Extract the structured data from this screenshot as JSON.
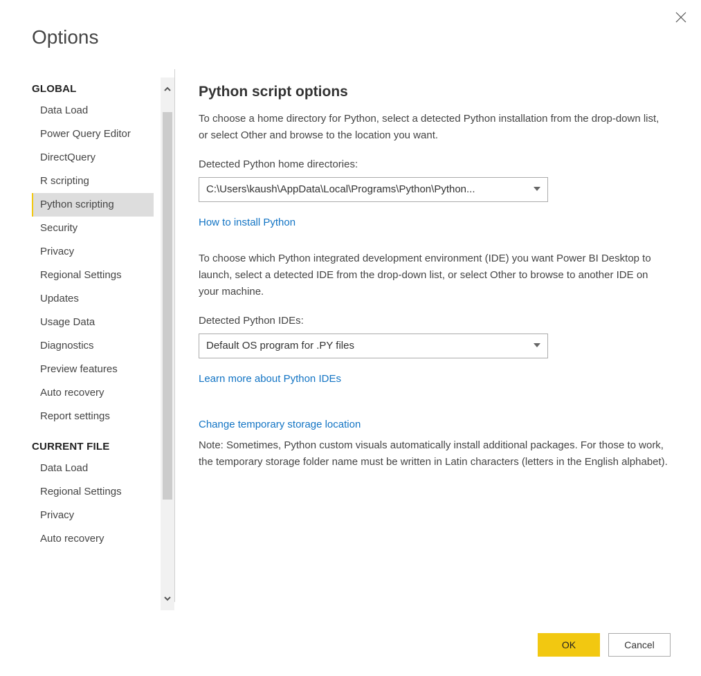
{
  "dialog_title": "Options",
  "sidebar": {
    "groups": [
      {
        "header": "GLOBAL",
        "items": [
          {
            "label": "Data Load",
            "selected": false
          },
          {
            "label": "Power Query Editor",
            "selected": false
          },
          {
            "label": "DirectQuery",
            "selected": false
          },
          {
            "label": "R scripting",
            "selected": false
          },
          {
            "label": "Python scripting",
            "selected": true
          },
          {
            "label": "Security",
            "selected": false
          },
          {
            "label": "Privacy",
            "selected": false
          },
          {
            "label": "Regional Settings",
            "selected": false
          },
          {
            "label": "Updates",
            "selected": false
          },
          {
            "label": "Usage Data",
            "selected": false
          },
          {
            "label": "Diagnostics",
            "selected": false
          },
          {
            "label": "Preview features",
            "selected": false
          },
          {
            "label": "Auto recovery",
            "selected": false
          },
          {
            "label": "Report settings",
            "selected": false
          }
        ]
      },
      {
        "header": "CURRENT FILE",
        "items": [
          {
            "label": "Data Load",
            "selected": false
          },
          {
            "label": "Regional Settings",
            "selected": false
          },
          {
            "label": "Privacy",
            "selected": false
          },
          {
            "label": "Auto recovery",
            "selected": false
          }
        ]
      }
    ]
  },
  "content": {
    "heading": "Python script options",
    "home_dir_intro": "To choose a home directory for Python, select a detected Python installation from the drop-down list, or select Other and browse to the location you want.",
    "home_dir_label": "Detected Python home directories:",
    "home_dir_value": "C:\\Users\\kaush\\AppData\\Local\\Programs\\Python\\Python...",
    "install_link": "How to install Python",
    "ide_intro": "To choose which Python integrated development environment (IDE) you want Power BI Desktop to launch, select a detected IDE from the drop-down list, or select Other to browse to another IDE on your machine.",
    "ide_label": "Detected Python IDEs:",
    "ide_value": "Default OS program for .PY files",
    "ide_link": "Learn more about Python IDEs",
    "storage_link": "Change temporary storage location",
    "storage_note": "Note: Sometimes, Python custom visuals automatically install additional packages. For those to work, the temporary storage folder name must be written in Latin characters (letters in the English alphabet)."
  },
  "footer": {
    "ok": "OK",
    "cancel": "Cancel"
  }
}
